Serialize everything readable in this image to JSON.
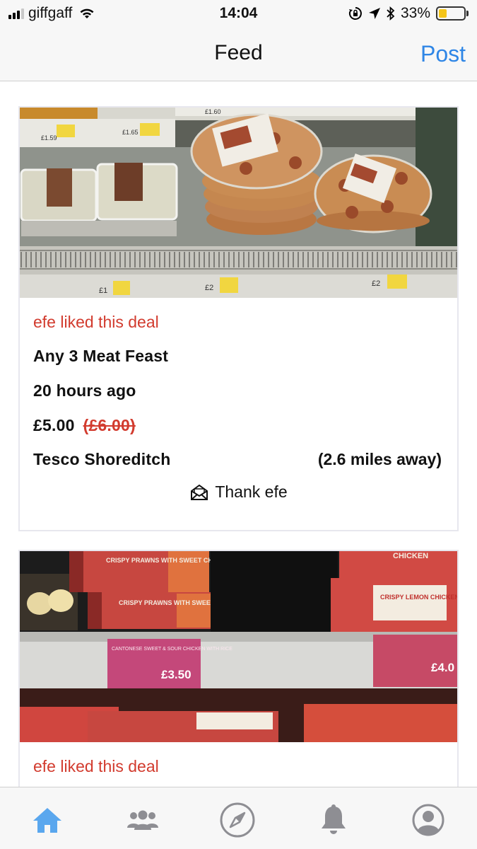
{
  "status_bar": {
    "carrier": "giffgaff",
    "time": "14:04",
    "battery_percent": "33%",
    "battery_level": 0.33,
    "icons": [
      "signal-icon",
      "wifi-icon",
      "orientation-lock-icon",
      "location-icon",
      "bluetooth-icon",
      "battery-icon"
    ]
  },
  "nav": {
    "title": "Feed",
    "post_label": "Post"
  },
  "feed": {
    "cards": [
      {
        "liked_text": "efe liked this deal",
        "product": "Any 3 Meat Feast",
        "time_ago": "20 hours ago",
        "price": "£5.00",
        "old_price": "(£6.00)",
        "store": "Tesco Shoreditch",
        "distance": "(2.6 miles away)",
        "thank_label": "Thank efe",
        "photo_shelf_labels": [
          "£1",
          "£2",
          "£2",
          "£1.60",
          "£1.59",
          "£1.65"
        ]
      },
      {
        "liked_text": "efe liked this deal",
        "photo_shelf_labels": [
          "CRISPY PRAWNS WITH SWEET CHILLI SAUCE",
          "CHICKEN",
          "CRISPY LEMON CHICKEN",
          "CANTONESE SWEET & SOUR CHICKEN WITH RICE",
          "£3.50",
          "£4.0"
        ]
      }
    ]
  },
  "tab_bar": {
    "tabs": [
      "home-icon",
      "groups-icon",
      "compass-icon",
      "bell-icon",
      "profile-icon"
    ],
    "active": "home-icon",
    "active_color": "#5aa7ee",
    "inactive_color": "#8e8e93"
  }
}
